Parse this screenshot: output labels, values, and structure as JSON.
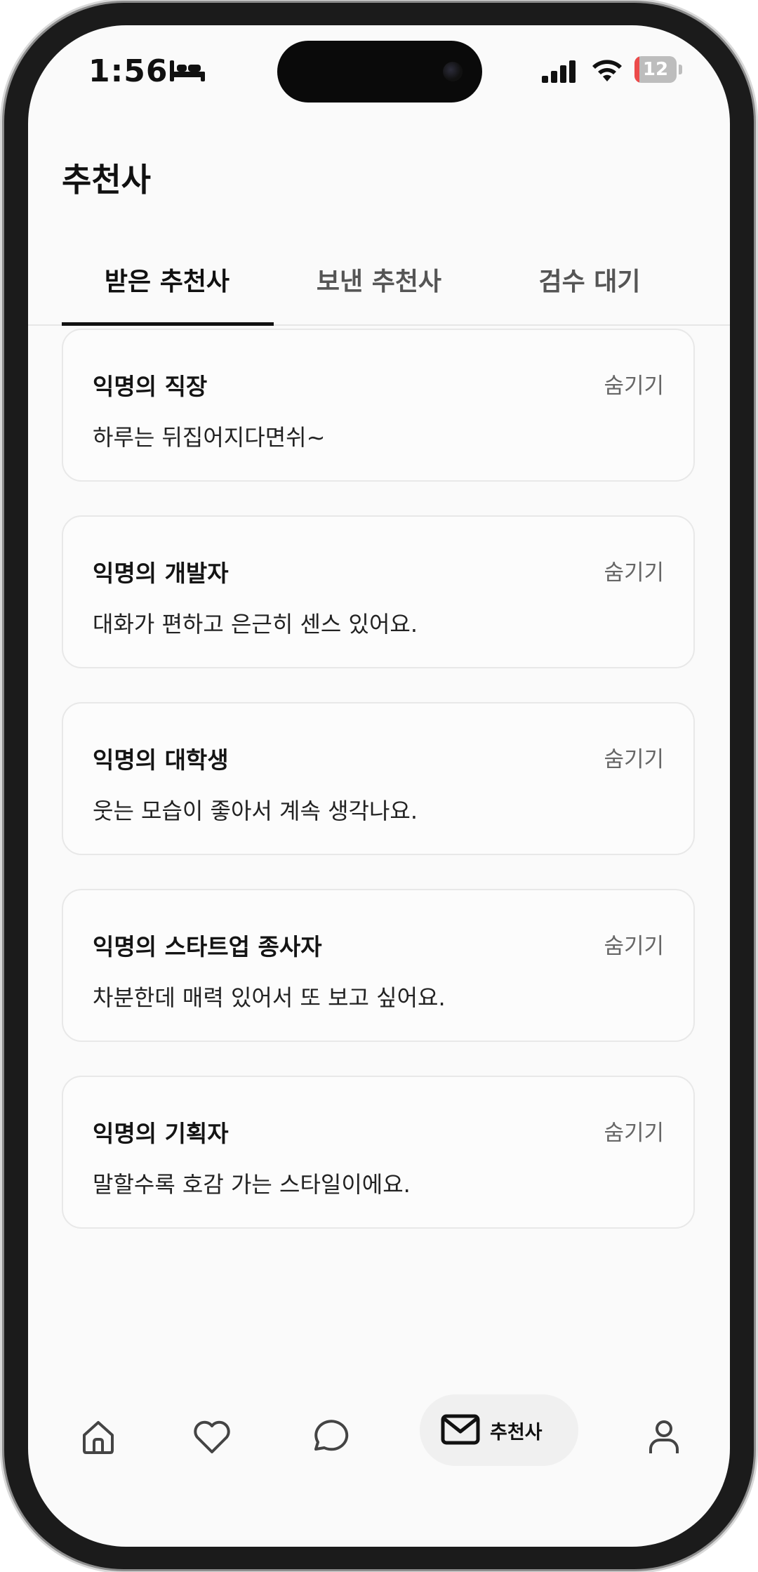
{
  "status_bar": {
    "time": "1:56",
    "battery_level": "12",
    "battery_fraction": 0.12,
    "icons": [
      "bed-icon",
      "signal-icon",
      "wifi-icon",
      "battery-icon"
    ]
  },
  "header": {
    "title": "추천사"
  },
  "tabs": [
    {
      "label": "받은 추천사",
      "active": true
    },
    {
      "label": "보낸 추천사",
      "active": false
    },
    {
      "label": "검수 대기",
      "active": false
    }
  ],
  "cards": [
    {
      "author": "익명의 직장",
      "action": "숨기기",
      "message": "하루는 뒤집어지다면쉬~"
    },
    {
      "author": "익명의 개발자",
      "action": "숨기기",
      "message": "대화가 편하고 은근히 센스 있어요."
    },
    {
      "author": "익명의 대학생",
      "action": "숨기기",
      "message": "웃는 모습이 좋아서 계속 생각나요."
    },
    {
      "author": "익명의 스타트업 종사자",
      "action": "숨기기",
      "message": "차분한데 매력 있어서 또 보고 싶어요."
    },
    {
      "author": "익명의 기획자",
      "action": "숨기기",
      "message": "말할수록 호감 가는 스타일이에요."
    }
  ],
  "bottom_nav": {
    "items": [
      {
        "icon": "home-icon"
      },
      {
        "icon": "heart-icon"
      },
      {
        "icon": "chat-bubble-icon"
      },
      {
        "icon": "mail-icon",
        "label": "추천사",
        "active": true
      },
      {
        "icon": "profile-icon"
      }
    ]
  },
  "colors": {
    "background": "#fafafa",
    "text_primary": "#111111",
    "text_secondary": "#666666",
    "card_border": "#e8e8e8",
    "battery_low": "#ec4a4a"
  }
}
